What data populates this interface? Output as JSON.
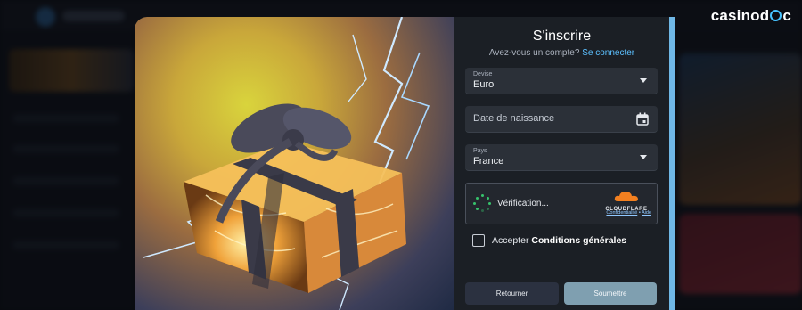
{
  "brand": {
    "name_prefix": "casinod",
    "name_suffix": "c"
  },
  "form": {
    "title": "S'inscrire",
    "have_account": "Avez-vous un compte?",
    "login_link": "Se connecter",
    "currency": {
      "label": "Devise",
      "value": "Euro"
    },
    "birthdate": {
      "placeholder": "Date de naissance"
    },
    "country": {
      "label": "Pays",
      "value": "France"
    },
    "captcha": {
      "status": "Vérification...",
      "provider": "CLOUDFLARE",
      "privacy": "Confidentialité",
      "separator": "•",
      "help": "Aide"
    },
    "terms": {
      "prefix": "Accepter",
      "bold": "Conditions générales"
    },
    "buttons": {
      "back": "Retourner",
      "submit": "Soumettre"
    }
  },
  "colors": {
    "accent_link": "#5cc0ff",
    "scroll_rail": "#6fb7e6",
    "spinner": "#37c26c",
    "cloudflare_orange": "#f38020",
    "submit_bg": "#7f9fb0"
  },
  "icons": [
    "calendar-icon",
    "chevron-down-icon",
    "cloudflare-logo",
    "spinner-icon"
  ]
}
